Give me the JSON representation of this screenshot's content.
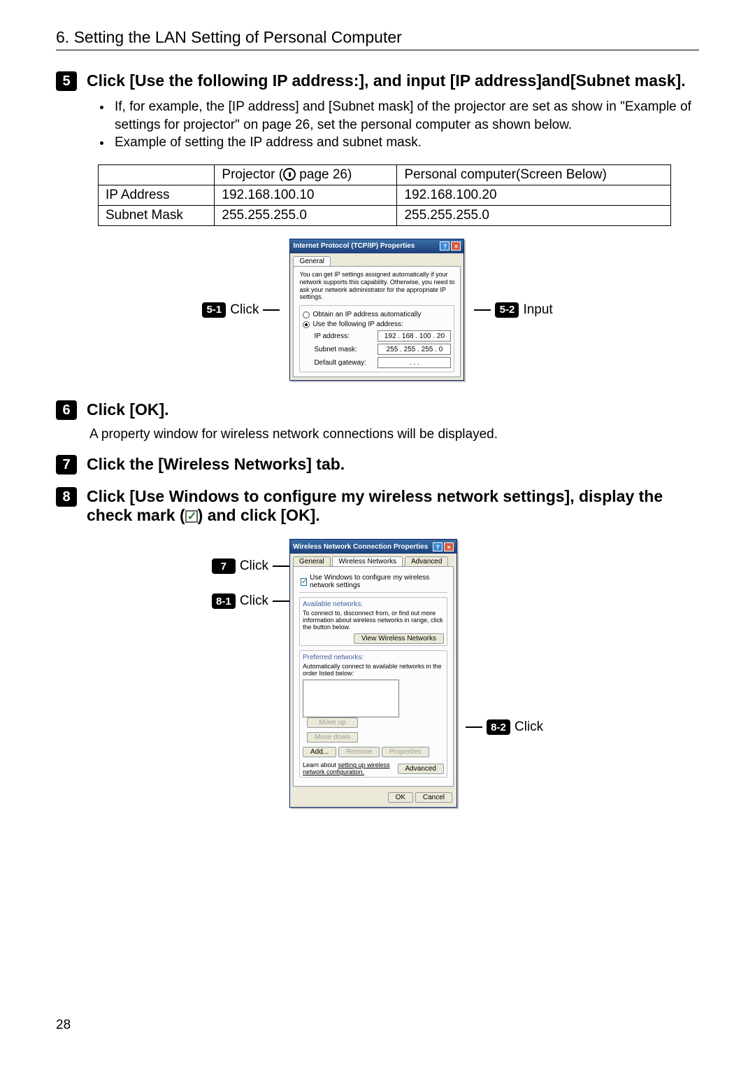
{
  "header": "6. Setting the LAN Setting of Personal Computer",
  "step5": {
    "num": "5",
    "title": "Click [Use the following IP address:], and input [IP address]and[Subnet mask].",
    "bullets": [
      "If, for example, the [IP address] and [Subnet mask] of the projector are set as show in \"Example of settings for projector\" on page 26, set the personal computer as shown below.",
      "Example of setting the IP address and subnet mask."
    ]
  },
  "table": {
    "col1": "",
    "col2_prefix": "Projector (",
    "col2_page": " page 26)",
    "col3": "Personal computer(Screen Below)",
    "r1c1": "IP Address",
    "r1c2": "192.168.100.10",
    "r1c3": "192.168.100.20",
    "r2c1": "Subnet Mask",
    "r2c2": "255.255.255.0",
    "r2c3": "255.255.255.0"
  },
  "fig1": {
    "left_badge": "5-1",
    "left_label": "Click",
    "right_badge": "5-2",
    "right_label": "Input",
    "title": "Internet Protocol (TCP/IP) Properties",
    "tab": "General",
    "desc": "You can get IP settings assigned automatically if your network supports this capability. Otherwise, you need to ask your network administrator for the appropriate IP settings.",
    "radio_auto": "Obtain an IP address automatically",
    "radio_use": "Use the following IP address:",
    "ip_label": "IP address:",
    "ip_val": "192 . 168 . 100 . 20",
    "mask_label": "Subnet mask:",
    "mask_val": "255 . 255 . 255 .  0",
    "gw_label": "Default gateway:",
    "gw_val": ".      .      ."
  },
  "step6": {
    "num": "6",
    "title": "Click [OK].",
    "body": "A property window for wireless network connections will be displayed."
  },
  "step7": {
    "num": "7",
    "title": "Click the [Wireless Networks] tab."
  },
  "step8": {
    "num": "8",
    "title_a": "Click [Use Windows to configure my wireless network settings], display the check mark (",
    "title_b": ") and click [OK]."
  },
  "fig2": {
    "l1_badge": "7",
    "l1_label": "Click",
    "l2_badge": "8-1",
    "l2_label": "Click",
    "r_badge": "8-2",
    "r_label": "Click",
    "title": "Wireless Network Connection Properties",
    "tab1": "General",
    "tab2": "Wireless Networks",
    "tab3": "Advanced",
    "chk": "Use Windows to configure my wireless network settings",
    "avail_label": "Available networks:",
    "avail_hint": "To connect to, disconnect from, or find out more information about wireless networks in range, click the button below.",
    "view_btn": "View Wireless Networks",
    "pref_label": "Preferred networks:",
    "pref_hint": "Automatically connect to available networks in the order listed below:",
    "moveup": "Move up",
    "movedown": "Move down",
    "add": "Add...",
    "remove": "Remove",
    "props": "Properties",
    "learn_a": "Learn about ",
    "learn_link": "setting up wireless network configuration.",
    "adv": "Advanced",
    "ok": "OK",
    "cancel": "Cancel"
  },
  "page_number": "28"
}
